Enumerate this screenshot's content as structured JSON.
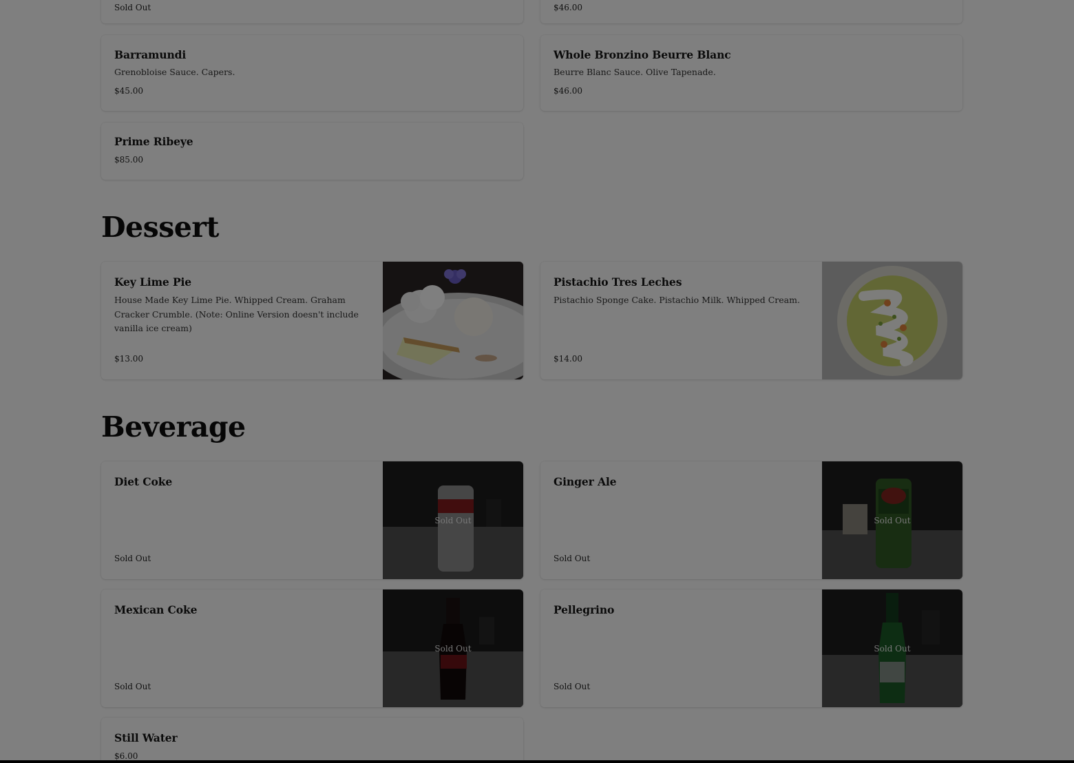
{
  "top_partial": {
    "left_status": "Sold Out",
    "right_price": "$46.00"
  },
  "entrees": {
    "items": [
      {
        "name": "Barramundi",
        "description": "Grenobloise Sauce. Capers.",
        "price": "$45.00"
      },
      {
        "name": "Whole Bronzino Beurre Blanc",
        "description": "Beurre Blanc Sauce. Olive Tapenade.",
        "price": "$46.00"
      },
      {
        "name": "Prime Ribeye",
        "description": "",
        "price": "$85.00"
      }
    ]
  },
  "dessert": {
    "title": "Dessert",
    "items": [
      {
        "name": "Key Lime Pie",
        "description": "House Made Key Lime Pie. Whipped Cream. Graham Cracker Crumble. (Note: Online Version doesn't include vanilla ice cream)",
        "price": "$13.00",
        "image_icon": "key-lime-pie-photo"
      },
      {
        "name": "Pistachio Tres Leches",
        "description": "Pistachio Sponge Cake. Pistachio Milk. Whipped Cream.",
        "price": "$14.00",
        "image_icon": "pistachio-tres-leches-photo"
      }
    ]
  },
  "beverage": {
    "title": "Beverage",
    "items": [
      {
        "name": "Diet Coke",
        "price": "Sold Out",
        "overlay": "Sold Out",
        "image_icon": "diet-coke-photo"
      },
      {
        "name": "Ginger Ale",
        "price": "Sold Out",
        "overlay": "Sold Out",
        "image_icon": "ginger-ale-photo"
      },
      {
        "name": "Mexican Coke",
        "price": "Sold Out",
        "overlay": "Sold Out",
        "image_icon": "mexican-coke-photo"
      },
      {
        "name": "Pellegrino",
        "price": "Sold Out",
        "overlay": "Sold Out",
        "image_icon": "pellegrino-photo"
      },
      {
        "name": "Still Water",
        "price": "$6.00"
      }
    ]
  },
  "colors": {
    "overlay_dim": "#000000",
    "card_bg": "#ffffff",
    "text": "#141414"
  }
}
